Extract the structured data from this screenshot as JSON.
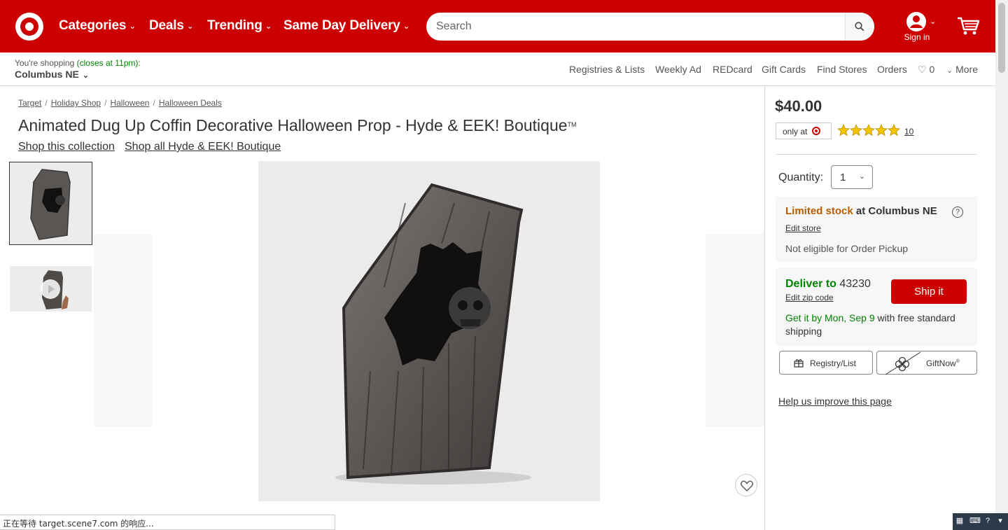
{
  "header": {
    "nav": [
      {
        "label": "Categories"
      },
      {
        "label": "Deals"
      },
      {
        "label": "Trending"
      },
      {
        "label": "Same Day Delivery"
      }
    ],
    "search_placeholder": "Search",
    "signin_label": "Sign in",
    "brand_color": "#cc0000"
  },
  "subheader": {
    "shopping_prefix": "You're shopping",
    "closes_text": "(closes at 11pm):",
    "store_name": "Columbus NE",
    "links": [
      "Registries & Lists",
      "Weekly Ad",
      "REDcard",
      "Gift Cards",
      "Find Stores",
      "Orders"
    ],
    "favorites_count": "0",
    "more_label": "More"
  },
  "breadcrumbs": [
    "Target",
    "Holiday Shop",
    "Halloween",
    "Halloween Deals"
  ],
  "product": {
    "title": "Animated Dug Up Coffin Decorative Halloween Prop - Hyde & EEK! Boutique",
    "trademark": "TM",
    "links": [
      "Shop this collection",
      "Shop all Hyde & EEK! Boutique"
    ],
    "price": "$40.00",
    "only_at": "only at",
    "rating": 5,
    "review_count": "10",
    "quantity_label": "Quantity:",
    "quantity_value": "1"
  },
  "fulfillment": {
    "stock_status": "Limited stock",
    "stock_location": "at Columbus NE",
    "edit_store": "Edit store",
    "pickup_note": "Not eligible for Order Pickup",
    "deliver_label": "Deliver to",
    "zip": "43230",
    "edit_zip": "Edit zip code",
    "ship_button": "Ship it",
    "get_it_date": "Get it by Mon, Sep 9",
    "get_it_rest": "with free standard shipping"
  },
  "actions": {
    "registry": "Registry/List",
    "giftnow": "GiftNow",
    "giftnow_mark": "®",
    "improve": "Help us improve this page"
  },
  "browser": {
    "status_text": "正在等待 target.scene7.com 的响应..."
  },
  "colors": {
    "green": "#008300",
    "warning": "#b85c00"
  }
}
